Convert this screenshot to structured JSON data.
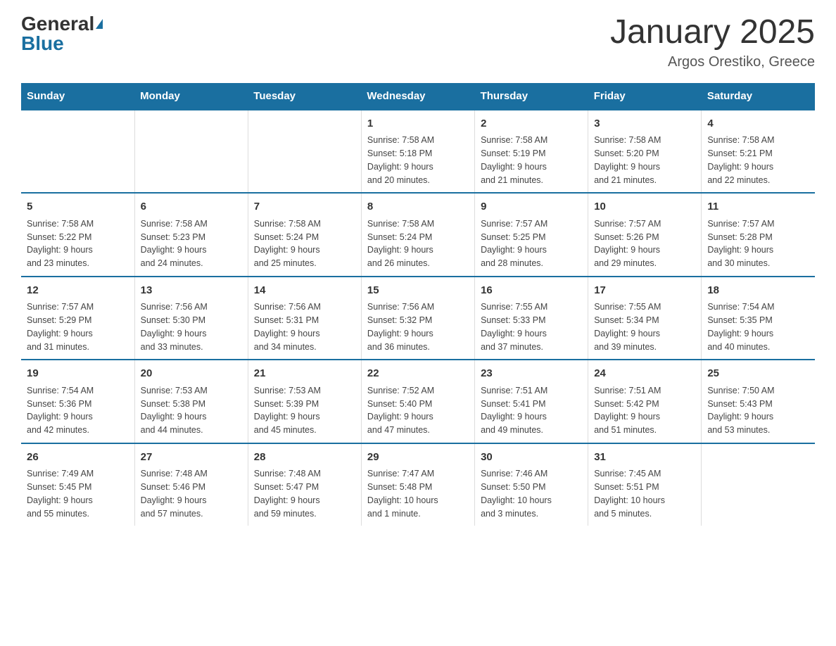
{
  "header": {
    "logo_general": "General",
    "logo_blue": "Blue",
    "month_title": "January 2025",
    "location": "Argos Orestiko, Greece"
  },
  "weekdays": [
    "Sunday",
    "Monday",
    "Tuesday",
    "Wednesday",
    "Thursday",
    "Friday",
    "Saturday"
  ],
  "weeks": [
    [
      {
        "day": "",
        "info": ""
      },
      {
        "day": "",
        "info": ""
      },
      {
        "day": "",
        "info": ""
      },
      {
        "day": "1",
        "info": "Sunrise: 7:58 AM\nSunset: 5:18 PM\nDaylight: 9 hours\nand 20 minutes."
      },
      {
        "day": "2",
        "info": "Sunrise: 7:58 AM\nSunset: 5:19 PM\nDaylight: 9 hours\nand 21 minutes."
      },
      {
        "day": "3",
        "info": "Sunrise: 7:58 AM\nSunset: 5:20 PM\nDaylight: 9 hours\nand 21 minutes."
      },
      {
        "day": "4",
        "info": "Sunrise: 7:58 AM\nSunset: 5:21 PM\nDaylight: 9 hours\nand 22 minutes."
      }
    ],
    [
      {
        "day": "5",
        "info": "Sunrise: 7:58 AM\nSunset: 5:22 PM\nDaylight: 9 hours\nand 23 minutes."
      },
      {
        "day": "6",
        "info": "Sunrise: 7:58 AM\nSunset: 5:23 PM\nDaylight: 9 hours\nand 24 minutes."
      },
      {
        "day": "7",
        "info": "Sunrise: 7:58 AM\nSunset: 5:24 PM\nDaylight: 9 hours\nand 25 minutes."
      },
      {
        "day": "8",
        "info": "Sunrise: 7:58 AM\nSunset: 5:24 PM\nDaylight: 9 hours\nand 26 minutes."
      },
      {
        "day": "9",
        "info": "Sunrise: 7:57 AM\nSunset: 5:25 PM\nDaylight: 9 hours\nand 28 minutes."
      },
      {
        "day": "10",
        "info": "Sunrise: 7:57 AM\nSunset: 5:26 PM\nDaylight: 9 hours\nand 29 minutes."
      },
      {
        "day": "11",
        "info": "Sunrise: 7:57 AM\nSunset: 5:28 PM\nDaylight: 9 hours\nand 30 minutes."
      }
    ],
    [
      {
        "day": "12",
        "info": "Sunrise: 7:57 AM\nSunset: 5:29 PM\nDaylight: 9 hours\nand 31 minutes."
      },
      {
        "day": "13",
        "info": "Sunrise: 7:56 AM\nSunset: 5:30 PM\nDaylight: 9 hours\nand 33 minutes."
      },
      {
        "day": "14",
        "info": "Sunrise: 7:56 AM\nSunset: 5:31 PM\nDaylight: 9 hours\nand 34 minutes."
      },
      {
        "day": "15",
        "info": "Sunrise: 7:56 AM\nSunset: 5:32 PM\nDaylight: 9 hours\nand 36 minutes."
      },
      {
        "day": "16",
        "info": "Sunrise: 7:55 AM\nSunset: 5:33 PM\nDaylight: 9 hours\nand 37 minutes."
      },
      {
        "day": "17",
        "info": "Sunrise: 7:55 AM\nSunset: 5:34 PM\nDaylight: 9 hours\nand 39 minutes."
      },
      {
        "day": "18",
        "info": "Sunrise: 7:54 AM\nSunset: 5:35 PM\nDaylight: 9 hours\nand 40 minutes."
      }
    ],
    [
      {
        "day": "19",
        "info": "Sunrise: 7:54 AM\nSunset: 5:36 PM\nDaylight: 9 hours\nand 42 minutes."
      },
      {
        "day": "20",
        "info": "Sunrise: 7:53 AM\nSunset: 5:38 PM\nDaylight: 9 hours\nand 44 minutes."
      },
      {
        "day": "21",
        "info": "Sunrise: 7:53 AM\nSunset: 5:39 PM\nDaylight: 9 hours\nand 45 minutes."
      },
      {
        "day": "22",
        "info": "Sunrise: 7:52 AM\nSunset: 5:40 PM\nDaylight: 9 hours\nand 47 minutes."
      },
      {
        "day": "23",
        "info": "Sunrise: 7:51 AM\nSunset: 5:41 PM\nDaylight: 9 hours\nand 49 minutes."
      },
      {
        "day": "24",
        "info": "Sunrise: 7:51 AM\nSunset: 5:42 PM\nDaylight: 9 hours\nand 51 minutes."
      },
      {
        "day": "25",
        "info": "Sunrise: 7:50 AM\nSunset: 5:43 PM\nDaylight: 9 hours\nand 53 minutes."
      }
    ],
    [
      {
        "day": "26",
        "info": "Sunrise: 7:49 AM\nSunset: 5:45 PM\nDaylight: 9 hours\nand 55 minutes."
      },
      {
        "day": "27",
        "info": "Sunrise: 7:48 AM\nSunset: 5:46 PM\nDaylight: 9 hours\nand 57 minutes."
      },
      {
        "day": "28",
        "info": "Sunrise: 7:48 AM\nSunset: 5:47 PM\nDaylight: 9 hours\nand 59 minutes."
      },
      {
        "day": "29",
        "info": "Sunrise: 7:47 AM\nSunset: 5:48 PM\nDaylight: 10 hours\nand 1 minute."
      },
      {
        "day": "30",
        "info": "Sunrise: 7:46 AM\nSunset: 5:50 PM\nDaylight: 10 hours\nand 3 minutes."
      },
      {
        "day": "31",
        "info": "Sunrise: 7:45 AM\nSunset: 5:51 PM\nDaylight: 10 hours\nand 5 minutes."
      },
      {
        "day": "",
        "info": ""
      }
    ]
  ]
}
